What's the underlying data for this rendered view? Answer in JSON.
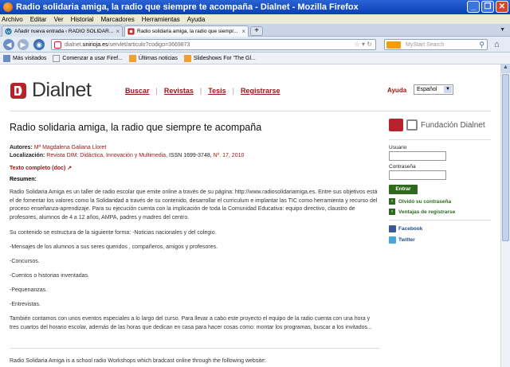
{
  "window": {
    "title": "Radio solidaria amiga, la radio que siempre te acompaña - Dialnet - Mozilla Firefox"
  },
  "menu": [
    "Archivo",
    "Editar",
    "Ver",
    "Historial",
    "Marcadores",
    "Herramientas",
    "Ayuda"
  ],
  "tabs": [
    {
      "label": "Añadir nueva entrada ‹ RADIO SOLIDAR...",
      "active": false
    },
    {
      "label": "Radio solidaria amiga, la radio que siempr...",
      "active": true
    }
  ],
  "url": {
    "host_prefix": "dialnet.",
    "host_main": "unirioja.es",
    "path": "/servlet/articulo?codigo=3669873"
  },
  "search": {
    "placeholder": "MyStart Search"
  },
  "bookmarks": [
    "Más visitados",
    "Comenzar a usar Firef...",
    "Últimas noticias",
    "Slideshows For 'The Gl..."
  ],
  "site": {
    "brand": "Dialnet",
    "nav": [
      "Buscar",
      "Revistas",
      "Tesis",
      "Registrarse"
    ],
    "help": "Ayuda",
    "language": "Español"
  },
  "article": {
    "title": "Radio solidaria amiga, la radio que siempre te acompaña",
    "authors_label": "Autores:",
    "authors": "Mª Magdalena Galiana Lloret",
    "location_label": "Localización:",
    "location_link": "Revista DIM: Didáctica, Innovación y Multimedia",
    "location_rest": ", ISSN 1699-3748, ",
    "location_issue": "Nº. 17, 2010",
    "fulltext": "Texto completo (doc)",
    "resumen_label": "Resumen:",
    "paragraphs": [
      "Radio Solidaria Amiga es un taller de radio escolar que emite online a través de su página: http://www.radiosolidariamiga.es. Entre sus objetivos está el de fomentar los valores como la Solidaridad a través de su contenido, desarrollar el curriculum e implantar las TIC como herramienta y recurso del proceso enseñanza-aprendizaje. Para su ejecución cuenta con la implicación de toda la Comunidad Educativa: equipo directivo, claustro de profesores, alumnos de 4 a 12 años, AMPA, padres y madres del centro.",
      "Su contenido se estructura de la siguiente forma: -Noticias nacionales y del colegio.",
      "-Mensajes de los alumnos a sus seres queridos , compañeros, amigos y profesores.",
      "-Concursos.",
      "-Cuentos o historias inventadas.",
      "-Pequenanzas.",
      "-Entrevistas.",
      "También contamos con unos eventos especiales a lo largo del curso. Para llevar a cabo este proyecto el equipo de la radio cuenta con una hora y tres cuartos del horario escolar, además de las horas que dedican en casa para hacer cosas como: montar los programas, buscar a los invitados...",
      "Radio Solidaria Amiga is a school radio Workshops which bradcast online through the following website:"
    ]
  },
  "sidebar": {
    "foundation": "Fundación Dialnet",
    "user_label": "Usuario",
    "password_label": "Contraseña",
    "login_button": "Entrar",
    "forgot": "Olvidó su contraseña",
    "register": "Ventajas de registrarse",
    "facebook": "Facebook",
    "twitter": "Twitter"
  },
  "colors": {
    "accent": "#9b1313",
    "green": "#2e6a1e"
  }
}
